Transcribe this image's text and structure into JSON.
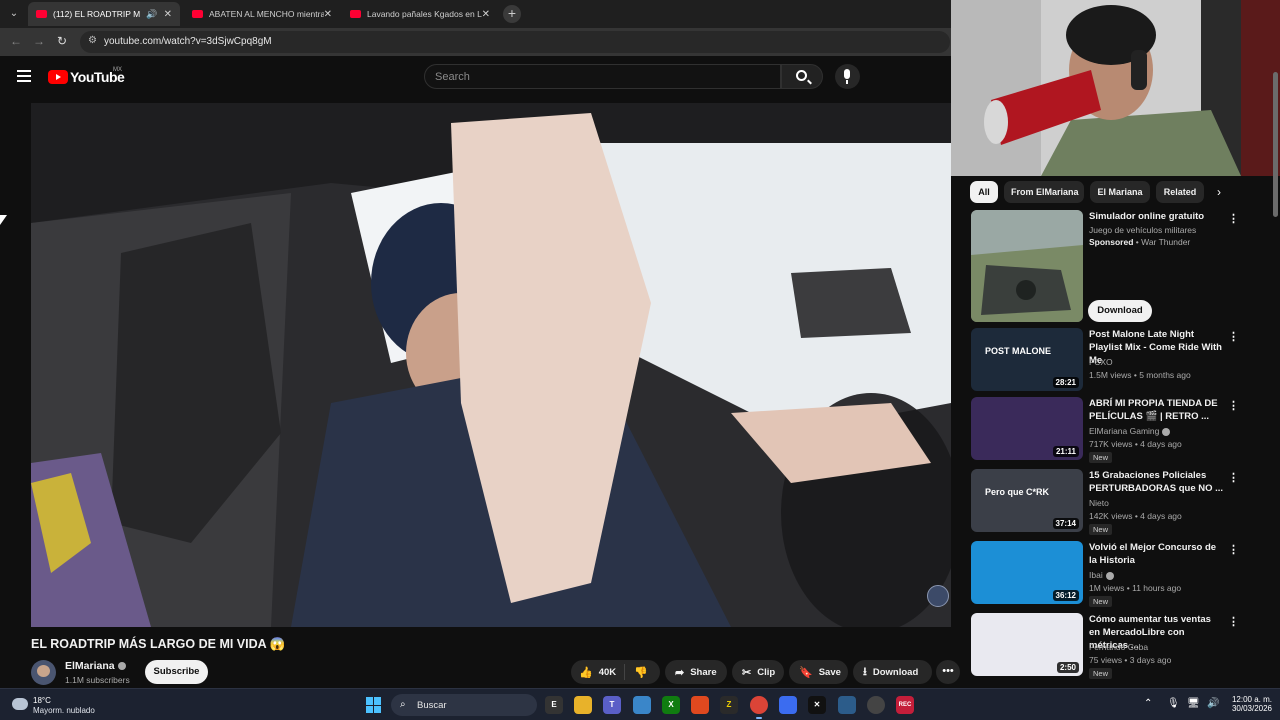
{
  "browser": {
    "tabs": [
      {
        "title": "(112) EL ROADTRIP MÁS LA",
        "active": true,
        "audio": true
      },
      {
        "title": "ABATEN AL MENCHO mientras",
        "active": false
      },
      {
        "title": "Lavando pañales Kgados en La",
        "active": false
      }
    ],
    "url": "youtube.com/watch?v=3dSjwCpq8gM"
  },
  "youtube": {
    "logo_text": "YouTube",
    "country_code": "MX",
    "search_placeholder": "Search"
  },
  "video": {
    "title": "EL ROADTRIP MÁS LARGO DE MI VIDA 😱",
    "channel": "ElMariana",
    "subscribers": "1.1M subscribers",
    "subscribe_label": "Subscribe",
    "likes": "40K",
    "share_label": "Share",
    "clip_label": "Clip",
    "save_label": "Save",
    "download_label": "Download"
  },
  "sidebar": {
    "chips": [
      "All",
      "From ElMariana",
      "El Mariana",
      "Related"
    ],
    "sponsored": {
      "title": "Simulador online gratuito",
      "subtitle": "Juego de vehículos militares",
      "sponsored_label": "Sponsored",
      "advertiser": "War Thunder",
      "button": "Download"
    },
    "videos": [
      {
        "title": "Post Malone Late Night Playlist Mix - Come Ride With Me",
        "channel": "FCXO",
        "meta": "1.5M views • 5 months ago",
        "duration": "28:21",
        "new": "",
        "verified": false,
        "thumb_color": "#1d2a3a",
        "thumb_text": "POST MALONE"
      },
      {
        "title": "ABRÍ MI PROPIA TIENDA DE PELÍCULAS 🎬 | RETRO ...",
        "channel": "ElMariana Gaming",
        "meta": "717K views • 4 days ago",
        "duration": "21:11",
        "new": "New",
        "verified": true,
        "thumb_color": "#3a2a5a",
        "thumb_text": ""
      },
      {
        "title": "15 Grabaciones Policiales PERTURBADORAS que NO ...",
        "channel": "Nieto",
        "meta": "142K views • 4 days ago",
        "duration": "37:14",
        "new": "New",
        "verified": false,
        "thumb_color": "#3b3f48",
        "thumb_text": "Pero que C*RK"
      },
      {
        "title": "Volvió el Mejor Concurso de la Historia",
        "channel": "Ibai",
        "meta": "1M views • 11 hours ago",
        "duration": "36:12",
        "new": "New",
        "verified": true,
        "thumb_color": "#1c8fd6",
        "thumb_text": ""
      },
      {
        "title": "Cómo aumentar tus ventas en MercadoLibre con métricas ...",
        "channel": "Fernando Coba",
        "meta": "75 views • 3 days ago",
        "duration": "2:50",
        "new": "New",
        "verified": false,
        "thumb_color": "#e9e9f0",
        "thumb_text": ""
      }
    ]
  },
  "taskbar": {
    "temperature": "18°C",
    "weather": "Mayorm. nublado",
    "search_label": "Buscar",
    "time": "12:00 a. m.",
    "date": "30/03/2026"
  }
}
